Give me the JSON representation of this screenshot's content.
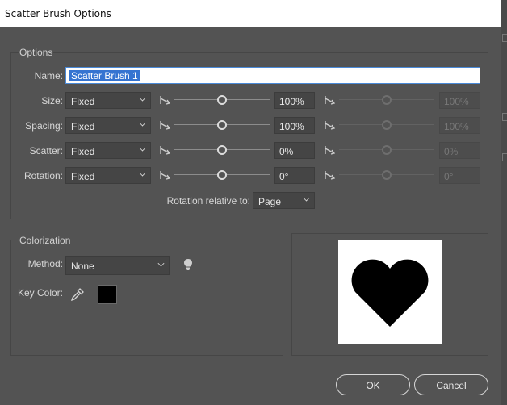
{
  "window": {
    "title": "Scatter Brush Options"
  },
  "options": {
    "group_label": "Options",
    "name_label": "Name:",
    "name_value": "Scatter Brush 1",
    "rows": [
      {
        "label": "Size:",
        "method": "Fixed",
        "value": "100%",
        "max_value": "100%",
        "level": 0.5
      },
      {
        "label": "Spacing:",
        "method": "Fixed",
        "value": "100%",
        "max_value": "100%",
        "level": 0.5
      },
      {
        "label": "Scatter:",
        "method": "Fixed",
        "value": "0%",
        "max_value": "0%",
        "level": 0.5
      },
      {
        "label": "Rotation:",
        "method": "Fixed",
        "value": "0°",
        "max_value": "0°",
        "level": 0.5
      }
    ],
    "rotation_relative_label": "Rotation relative to:",
    "rotation_relative_value": "Page"
  },
  "colorization": {
    "group_label": "Colorization",
    "method_label": "Method:",
    "method_value": "None",
    "key_color_label": "Key Color:",
    "key_color": "#000000",
    "tips_icon": "lightbulb-icon",
    "eyedropper_icon": "eyedropper-icon"
  },
  "preview": {
    "shape_icon": "heart-icon"
  },
  "buttons": {
    "ok": "OK",
    "cancel": "Cancel"
  }
}
